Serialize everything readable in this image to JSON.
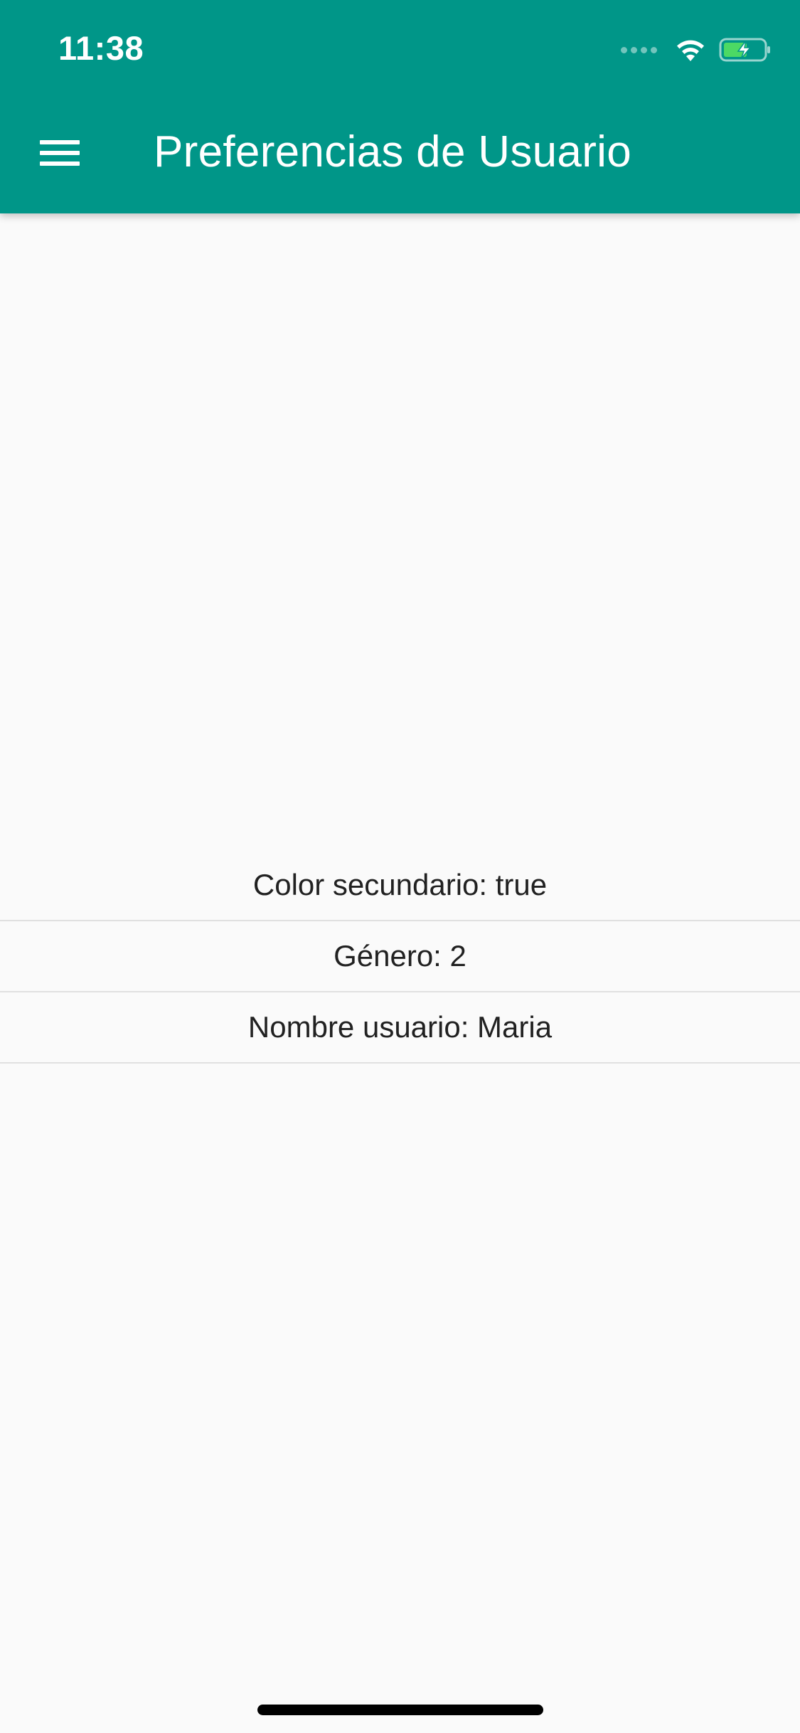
{
  "status_bar": {
    "time": "11:38",
    "icons": [
      "signal-dots-icon",
      "wifi-icon",
      "battery-charging-icon"
    ]
  },
  "app_bar": {
    "menu_icon": "hamburger-menu-icon",
    "title": "Preferencias de Usuario",
    "background_color": "#009688"
  },
  "preferences": [
    {
      "text": "Color secundario: true"
    },
    {
      "text": "Género: 2"
    },
    {
      "text": "Nombre usuario: Maria"
    }
  ],
  "colors": {
    "battery_fill": "#4cd964",
    "background": "#fafafa"
  }
}
